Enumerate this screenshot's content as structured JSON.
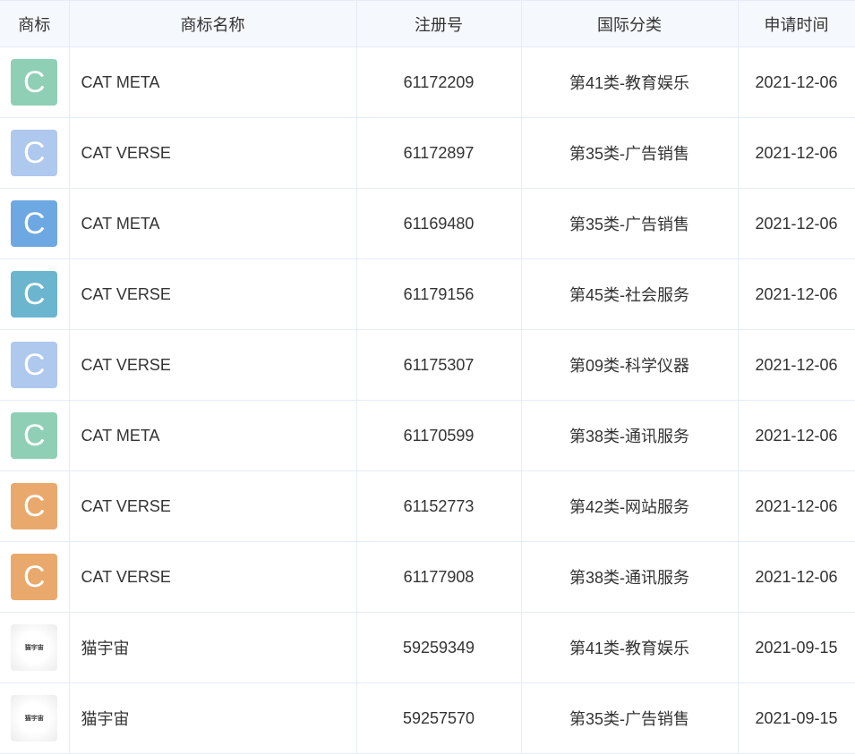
{
  "headers": [
    "商标",
    "商标名称",
    "注册号",
    "国际分类",
    "申请时间"
  ],
  "rows": [
    {
      "logo_text": "C",
      "logo_color": "#8fcfb5",
      "logo_type": "letter",
      "name": "CAT META",
      "reg_no": "61172209",
      "category": "第41类-教育娱乐",
      "date": "2021-12-06"
    },
    {
      "logo_text": "C",
      "logo_color": "#aec8ee",
      "logo_type": "letter",
      "name": "CAT VERSE",
      "reg_no": "61172897",
      "category": "第35类-广告销售",
      "date": "2021-12-06"
    },
    {
      "logo_text": "C",
      "logo_color": "#6ea8e2",
      "logo_type": "letter",
      "name": "CAT META",
      "reg_no": "61169480",
      "category": "第35类-广告销售",
      "date": "2021-12-06"
    },
    {
      "logo_text": "C",
      "logo_color": "#6bb5cf",
      "logo_type": "letter",
      "name": "CAT VERSE",
      "reg_no": "61179156",
      "category": "第45类-社会服务",
      "date": "2021-12-06"
    },
    {
      "logo_text": "C",
      "logo_color": "#aec8ee",
      "logo_type": "letter",
      "name": "CAT VERSE",
      "reg_no": "61175307",
      "category": "第09类-科学仪器",
      "date": "2021-12-06"
    },
    {
      "logo_text": "C",
      "logo_color": "#8fcfb5",
      "logo_type": "letter",
      "name": "CAT META",
      "reg_no": "61170599",
      "category": "第38类-通讯服务",
      "date": "2021-12-06"
    },
    {
      "logo_text": "C",
      "logo_color": "#e9a96c",
      "logo_type": "letter",
      "name": "CAT VERSE",
      "reg_no": "61152773",
      "category": "第42类-网站服务",
      "date": "2021-12-06"
    },
    {
      "logo_text": "C",
      "logo_color": "#e9a96c",
      "logo_type": "letter",
      "name": "CAT VERSE",
      "reg_no": "61177908",
      "category": "第38类-通讯服务",
      "date": "2021-12-06"
    },
    {
      "logo_text": "猫宇宙",
      "logo_color": "",
      "logo_type": "image",
      "name": "猫宇宙",
      "reg_no": "59259349",
      "category": "第41类-教育娱乐",
      "date": "2021-09-15"
    },
    {
      "logo_text": "猫宇宙",
      "logo_color": "",
      "logo_type": "image",
      "name": "猫宇宙",
      "reg_no": "59257570",
      "category": "第35类-广告销售",
      "date": "2021-09-15"
    }
  ]
}
